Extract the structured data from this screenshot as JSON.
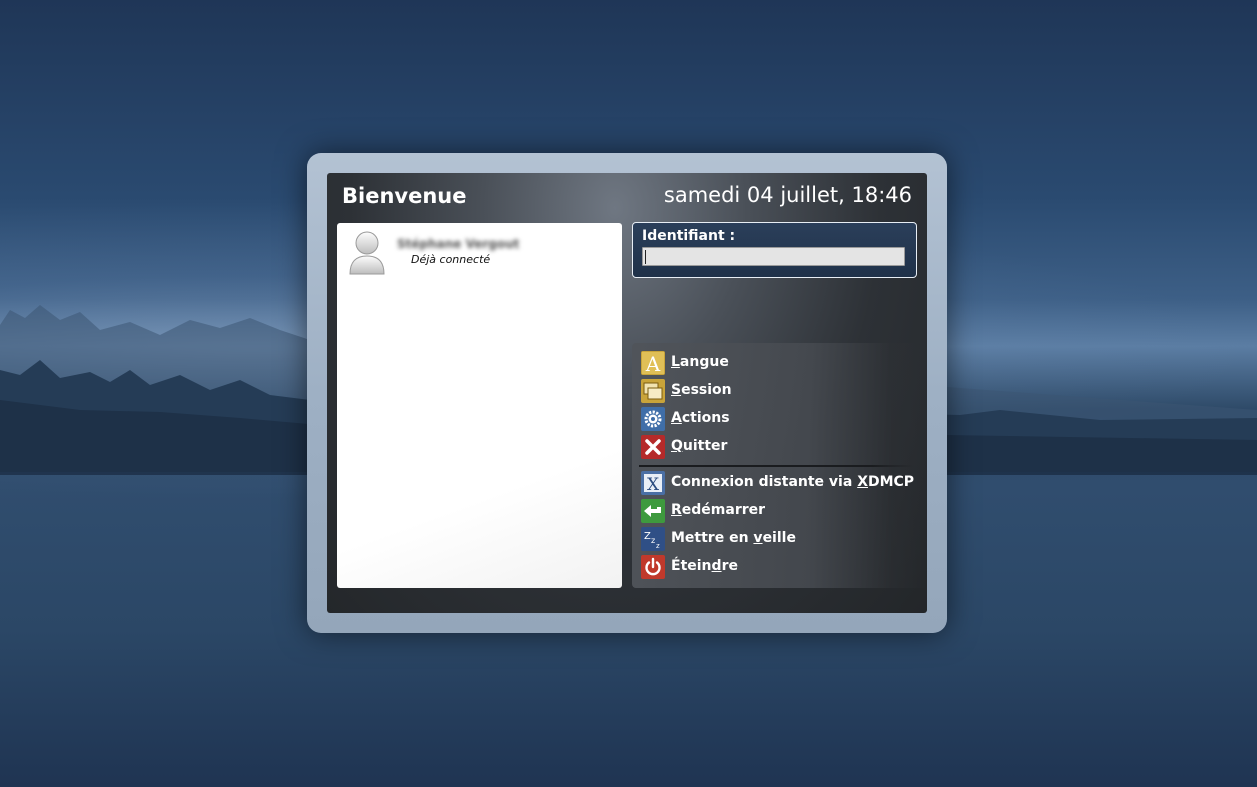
{
  "greeter": {
    "welcome": "Bienvenue",
    "datetime": "samedi 04 juillet, 18:46"
  },
  "users": [
    {
      "name": "Stéphane Vergout",
      "status": "Déjà connecté",
      "icon": "user-avatar-icon"
    }
  ],
  "login": {
    "label": "Identifiant :",
    "value": ""
  },
  "menu": {
    "items": [
      {
        "label": "Langue",
        "mnemonic": "L",
        "icon": "language-icon"
      },
      {
        "label": "Session",
        "mnemonic": "S",
        "icon": "session-icon"
      },
      {
        "label": "Actions",
        "mnemonic": "A",
        "icon": "actions-gear-icon"
      },
      {
        "label": "Quitter",
        "mnemonic": "Q",
        "icon": "quit-icon"
      },
      {
        "label": "Connexion distante via XDMCP",
        "mnemonic": "X",
        "icon": "xdmcp-icon"
      },
      {
        "label": "Redémarrer",
        "mnemonic": "R",
        "icon": "restart-icon"
      },
      {
        "label": "Mettre en veille",
        "mnemonic": "v",
        "icon": "suspend-icon"
      },
      {
        "label": "Éteindre",
        "mnemonic": "d",
        "icon": "shutdown-icon"
      }
    ]
  },
  "colors": {
    "panel_dark": "#2d3136",
    "login_box_blue": "#2b3f5a",
    "frame_border": "#9eb0c4"
  }
}
